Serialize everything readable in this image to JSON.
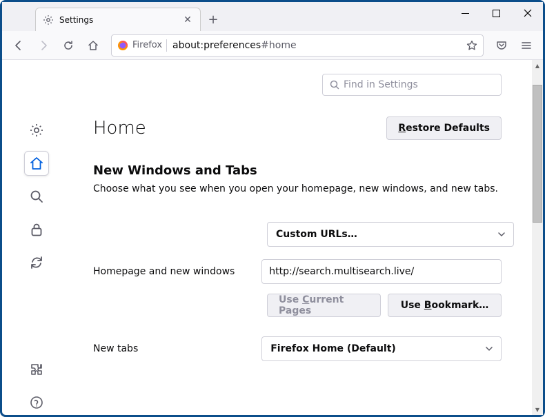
{
  "window": {
    "tab_title": "Settings",
    "url_identity": "Firefox",
    "url_prefix": "about:preferences",
    "url_suffix": "#home"
  },
  "search": {
    "placeholder": "Find in Settings"
  },
  "page": {
    "title": "Home",
    "restore_btn": "Restore Defaults"
  },
  "section": {
    "heading": "New Windows and Tabs",
    "desc": "Choose what you see when you open your homepage, new windows, and new tabs."
  },
  "form": {
    "custom_urls_label": "Custom URLs…",
    "homepage_label": "Homepage and new windows",
    "homepage_value": "http://search.multisearch.live/",
    "use_current_btn": "Use Current Pages",
    "use_bookmark_btn": "Use Bookmark…",
    "newtabs_label": "New tabs",
    "newtabs_value": "Firefox Home (Default)"
  }
}
